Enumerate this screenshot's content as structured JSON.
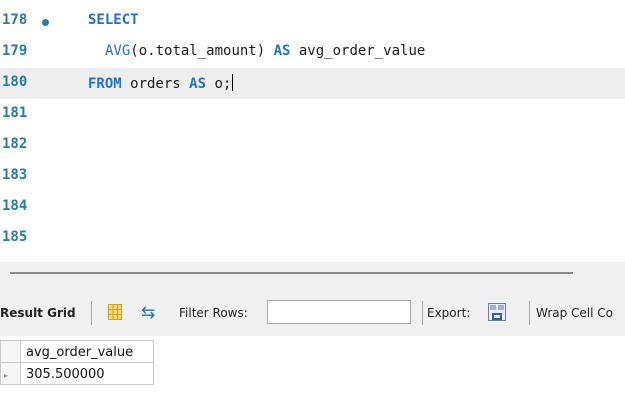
{
  "editor": {
    "lines": [
      {
        "num": "178",
        "has_dot": true
      },
      {
        "num": "179"
      },
      {
        "num": "180",
        "current": true
      },
      {
        "num": "181"
      },
      {
        "num": "182"
      },
      {
        "num": "183"
      },
      {
        "num": "184"
      },
      {
        "num": "185"
      }
    ],
    "code": {
      "select_kw": "SELECT",
      "avg_fn": "AVG",
      "avg_args": "(o.total_amount) ",
      "as_kw_1": "AS",
      "alias": " avg_order_value",
      "from_kw": "FROM",
      "table_part": " orders ",
      "as_kw_2": "AS",
      "table_alias": " o;"
    }
  },
  "toolbar": {
    "result_grid_label": "Result Grid",
    "filter_rows_label": "Filter Rows:",
    "filter_rows_value": "",
    "export_label": "Export:",
    "wrap_cell_label": "Wrap Cell Co"
  },
  "grid": {
    "columns": [
      "avg_order_value"
    ],
    "rows": [
      [
        "305.500000"
      ]
    ]
  },
  "colors": {
    "line_number": "#2b7aa1",
    "keyword": "#1f73c9",
    "current_line_bg": "#eeeeee",
    "toolbar_bg": "#f0f0f0"
  },
  "icons": [
    "breakpoint-dot-icon",
    "grid-view-icon",
    "refresh-icon",
    "export-icon"
  ]
}
